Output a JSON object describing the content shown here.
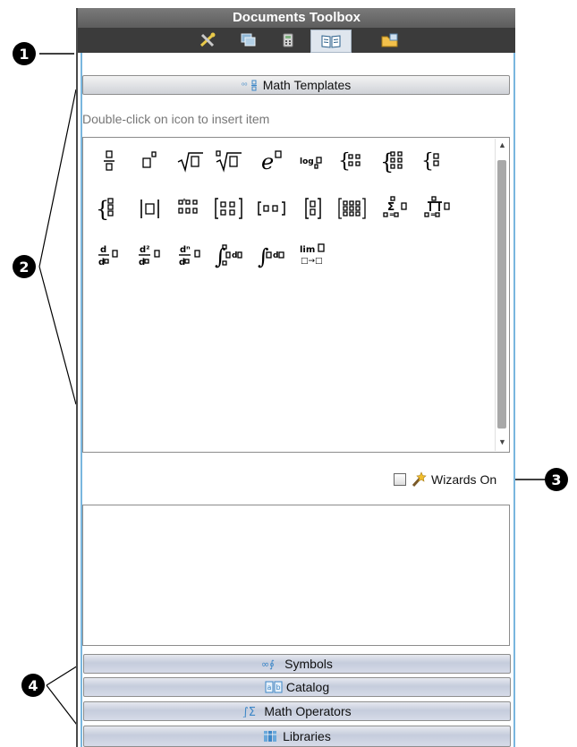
{
  "toolbox": {
    "title": "Documents Toolbox",
    "tabs": [
      {
        "icon": "utilities-icon"
      },
      {
        "icon": "page-sorter-icon"
      },
      {
        "icon": "scratchpad-icon"
      },
      {
        "icon": "documents-toolbox-icon",
        "active": true
      },
      {
        "icon": "content-explorer-icon"
      }
    ]
  },
  "math_templates": {
    "header_label": "Math Templates",
    "hint": "Double-click on icon to insert item",
    "templates": [
      {
        "name": "fraction-template-icon"
      },
      {
        "name": "exponent-template-icon"
      },
      {
        "name": "square-root-template-icon"
      },
      {
        "name": "nth-root-template-icon"
      },
      {
        "name": "e-exponent-template-icon"
      },
      {
        "name": "log-template-icon",
        "text": "log"
      },
      {
        "name": "piecewise-2-template-icon"
      },
      {
        "name": "piecewise-n-template-icon"
      },
      {
        "name": "system-2-template-icon"
      },
      {
        "name": "system-n-template-icon"
      },
      {
        "name": "absolute-value-template-icon"
      },
      {
        "name": "degree-minute-second-template-icon"
      },
      {
        "name": "matrix-2x2-template-icon"
      },
      {
        "name": "row-vector-template-icon"
      },
      {
        "name": "column-vector-template-icon"
      },
      {
        "name": "matrix-mxn-template-icon"
      },
      {
        "name": "sum-template-icon"
      },
      {
        "name": "product-template-icon"
      },
      {
        "name": "first-derivative-template-icon",
        "text": "d"
      },
      {
        "name": "second-derivative-template-icon",
        "text": "d²"
      },
      {
        "name": "nth-derivative-template-icon",
        "text": "dⁿ"
      },
      {
        "name": "definite-integral-template-icon"
      },
      {
        "name": "indefinite-integral-template-icon"
      },
      {
        "name": "limit-template-icon",
        "text": "lim",
        "subtext": "□→□"
      }
    ]
  },
  "wizards": {
    "label": "Wizards On",
    "checked": false
  },
  "sections": [
    {
      "label": "Symbols",
      "icon": "symbols-icon"
    },
    {
      "label": "Catalog",
      "icon": "catalog-icon"
    },
    {
      "label": "Math Operators",
      "icon": "math-operators-icon"
    },
    {
      "label": "Libraries",
      "icon": "libraries-icon"
    }
  ],
  "callouts": [
    "1",
    "2",
    "3",
    "4"
  ],
  "colors": {
    "accent_border": "#79b6de",
    "title_bar": "#5d5d5d",
    "tab_bar": "#3b3b3b"
  }
}
